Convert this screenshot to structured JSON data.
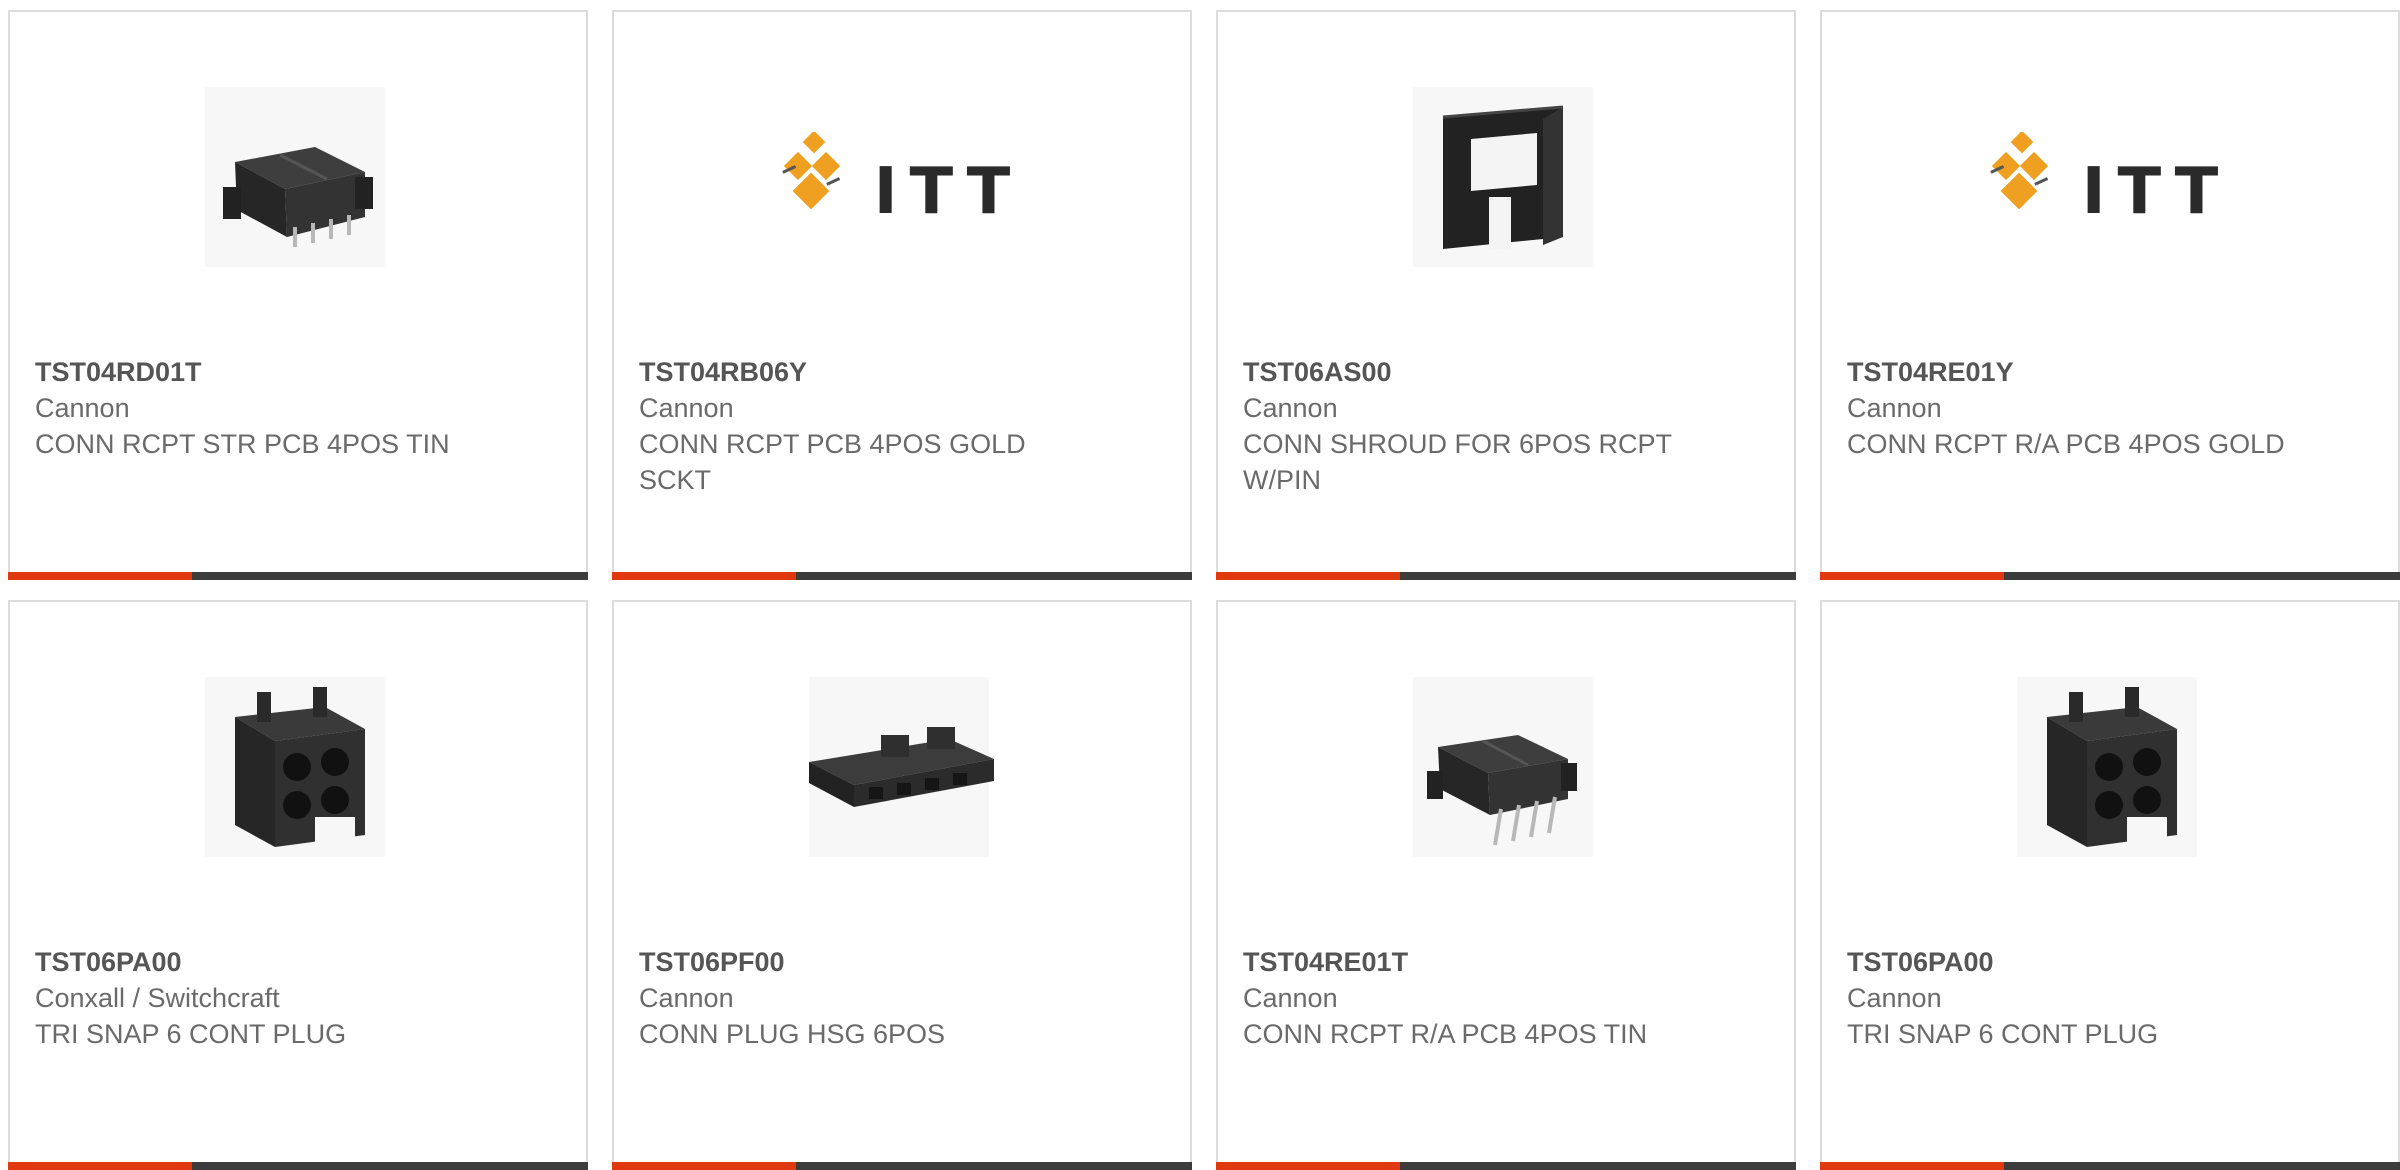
{
  "products": [
    {
      "part_number": "TST04RD01T",
      "manufacturer": "Cannon",
      "description": "CONN RCPT STR PCB 4POS TIN",
      "image": "connector-rcpt-pcb-4pos"
    },
    {
      "part_number": "TST04RB06Y",
      "manufacturer": "Cannon",
      "description": "CONN RCPT PCB 4POS GOLD SCKT",
      "image": "itt-logo",
      "logo_text": "ITT"
    },
    {
      "part_number": "TST06AS00",
      "manufacturer": "Cannon",
      "description": "CONN SHROUD FOR 6POS RCPT W/PIN",
      "image": "connector-shroud"
    },
    {
      "part_number": "TST04RE01Y",
      "manufacturer": "Cannon",
      "description": "CONN RCPT R/A PCB 4POS GOLD",
      "image": "itt-logo",
      "logo_text": "ITT"
    },
    {
      "part_number": "TST06PA00",
      "manufacturer": "Conxall / Switchcraft",
      "description": "TRI SNAP 6 CONT PLUG",
      "image": "connector-plug-housing"
    },
    {
      "part_number": "TST06PF00",
      "manufacturer": "Cannon",
      "description": "CONN PLUG HSG 6POS",
      "image": "connector-plug-hsg-flat"
    },
    {
      "part_number": "TST04RE01T",
      "manufacturer": "Cannon",
      "description": "CONN RCPT R/A PCB 4POS TIN",
      "image": "connector-rcpt-ra-pcb"
    },
    {
      "part_number": "TST06PA00",
      "manufacturer": "Cannon",
      "description": "TRI SNAP 6 CONT PLUG",
      "image": "connector-plug-housing"
    }
  ],
  "colors": {
    "accent": "#e0380f",
    "bar": "#3c3c3c",
    "logo_orange": "#f0a020"
  }
}
